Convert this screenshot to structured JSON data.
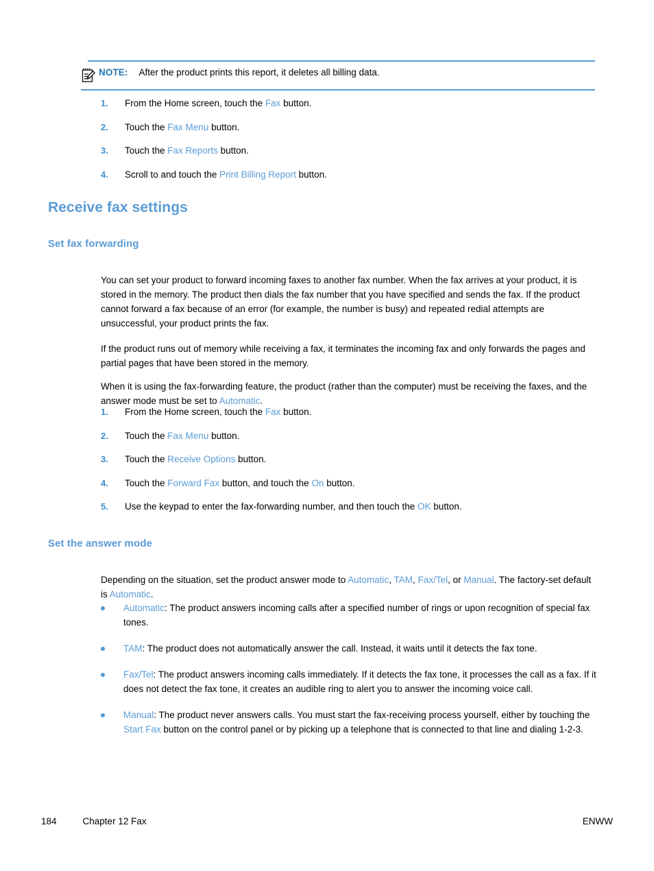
{
  "note": {
    "icon": "note-pencil-icon",
    "label": "NOTE:",
    "text": "After the product prints this report, it deletes all billing data.",
    "rule_color": "#5a9bd4",
    "label_color": "#1f74b5"
  },
  "billing_steps": [
    {
      "num": "1.",
      "pre": "From the Home screen, touch the ",
      "ui": "Fax",
      "post": " button."
    },
    {
      "num": "2.",
      "pre": "Touch the ",
      "ui": "Fax Menu",
      "post": " button."
    },
    {
      "num": "3.",
      "pre": "Touch the ",
      "ui": "Fax Reports",
      "post": " button."
    },
    {
      "num": "4.",
      "pre": "Scroll to and touch the ",
      "ui": "Print Billing Report",
      "post": " button."
    }
  ],
  "section_title": "Receive fax settings",
  "subsection_forwarding": {
    "title": "Set fax forwarding",
    "p1": "You can set your product to forward incoming faxes to another fax number. When the fax arrives at your product, it is stored in the memory. The product then dials the fax number that you have specified and sends the fax. If the product cannot forward a fax because of an error (for example, the number is busy) and repeated redial attempts are unsuccessful, your product prints the fax.",
    "p2": "If the product runs out of memory while receiving a fax, it terminates the incoming fax and only forwards the pages and partial pages that have been stored in the memory.",
    "p3_pre": "When it is using the fax-forwarding feature, the product (rather than the computer) must be receiving the faxes, and the answer mode must be set to ",
    "p3_ui": "Automatic",
    "p3_post": "."
  },
  "forwarding_steps": [
    {
      "num": "1.",
      "pre": "From the Home screen, touch the ",
      "ui": "Fax",
      "post": " button."
    },
    {
      "num": "2.",
      "pre": "Touch the ",
      "ui": "Fax Menu",
      "post": " button."
    },
    {
      "num": "3.",
      "pre": "Touch the ",
      "ui": "Receive Options",
      "post": " button."
    },
    {
      "num": "4.",
      "pre": "Touch the ",
      "ui": "Forward Fax",
      "post": " button, and touch the ",
      "ui2": "On",
      "post2": " button."
    },
    {
      "num": "5.",
      "pre": "Use the keypad to enter the fax-forwarding number, and then touch the ",
      "ui": "OK",
      "post": " button."
    }
  ],
  "subsection_answer_mode": {
    "title": "Set the answer mode",
    "intro_pre": "Depending on the situation, set the product answer mode to ",
    "intro_ui1": "Automatic",
    "intro_sep1": ", ",
    "intro_ui2": "TAM",
    "intro_sep2": ", ",
    "intro_ui3": "Fax/Tel",
    "intro_sep3": ", or ",
    "intro_ui4": "Manual",
    "intro_mid": ". The factory-set default is ",
    "intro_ui5": "Automatic",
    "intro_end": "."
  },
  "answer_mode_items": [
    {
      "ui": "Automatic",
      "text": ": The product answers incoming calls after a specified number of rings or upon recognition of special fax tones."
    },
    {
      "ui": "TAM",
      "text": ": The product does not automatically answer the call. Instead, it waits until it detects the fax tone."
    },
    {
      "ui": "Fax/Tel",
      "text": ": The product answers incoming calls immediately. If it detects the fax tone, it processes the call as a fax. If it does not detect the fax tone, it creates an audible ring to alert you to answer the incoming voice call."
    },
    {
      "ui": "Manual",
      "text_pre": ": The product never answers calls. You must start the fax-receiving process yourself, either by touching the ",
      "ui2": "Start Fax",
      "text_post": " button on the control panel or by picking up a telephone that is connected to that line and dialing 1-2-3."
    }
  ],
  "footer": {
    "page_number": "184",
    "chapter": "Chapter 12   Fax",
    "right": "ENWW"
  },
  "colors": {
    "accent_blue": "#5a9bd4",
    "note_blue": "#1f74b5",
    "number_blue": "#3f8ecb",
    "text_black": "#000000"
  }
}
